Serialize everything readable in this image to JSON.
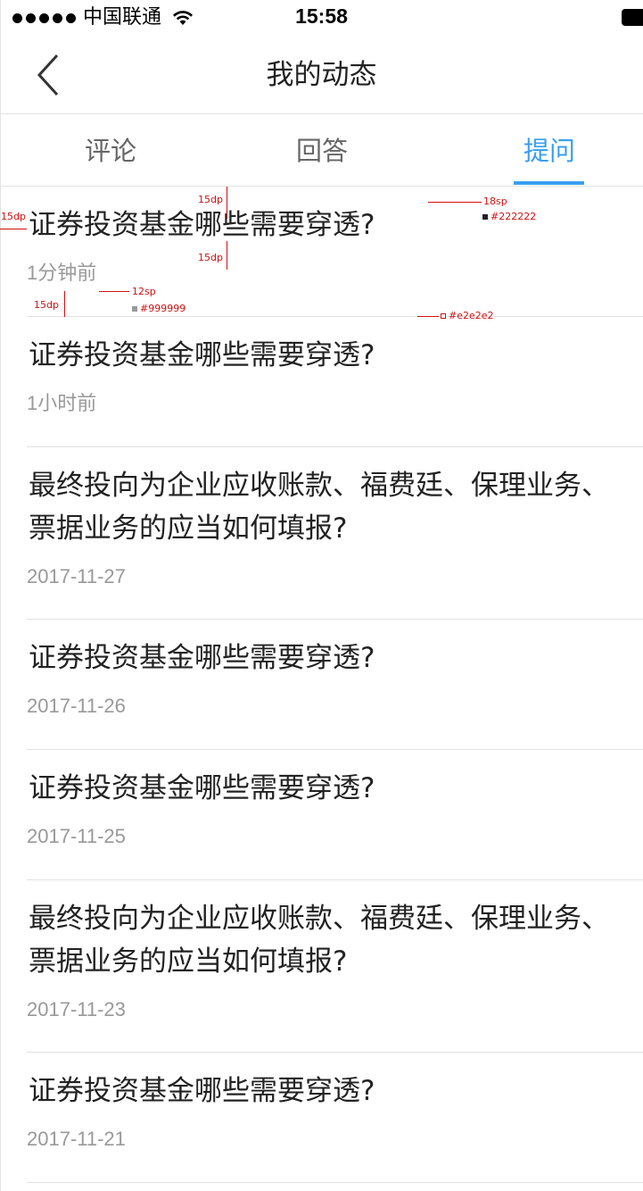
{
  "status_bar": {
    "carrier": "中国联通",
    "time": "15:58"
  },
  "nav": {
    "title": "我的动态"
  },
  "tabs": [
    {
      "label": "评论"
    },
    {
      "label": "回答"
    },
    {
      "label": "提问"
    }
  ],
  "active_tab_color": "#3a9ef0",
  "items": [
    {
      "title": "证券投资基金哪些需要穿透?",
      "time": "1分钟前"
    },
    {
      "title": "证券投资基金哪些需要穿透?",
      "time": "1小时前"
    },
    {
      "title": "最终投向为企业应收账款、福费廷、保理业务、票据业务的应当如何填报?",
      "time": "2017-11-27"
    },
    {
      "title": "证券投资基金哪些需要穿透?",
      "time": "2017-11-26"
    },
    {
      "title": "证券投资基金哪些需要穿透?",
      "time": "2017-11-25"
    },
    {
      "title": "最终投向为企业应收账款、福费廷、保理业务、票据业务的应当如何填报?",
      "time": "2017-11-23"
    },
    {
      "title": "证券投资基金哪些需要穿透?",
      "time": "2017-11-21"
    }
  ],
  "annotations": {
    "margin_left": "15dp",
    "gap_top": "15dp",
    "gap_middle": "15dp",
    "gap_bottom": "15dp",
    "title_size": "18sp",
    "title_color": "#222222",
    "time_size": "12sp",
    "time_color": "#999999",
    "divider_color": "#e2e2e2"
  },
  "icons": {
    "back": "chevron-left-icon",
    "wifi": "wifi-icon",
    "battery": "battery-icon",
    "signal": "signal-dots-icon"
  }
}
